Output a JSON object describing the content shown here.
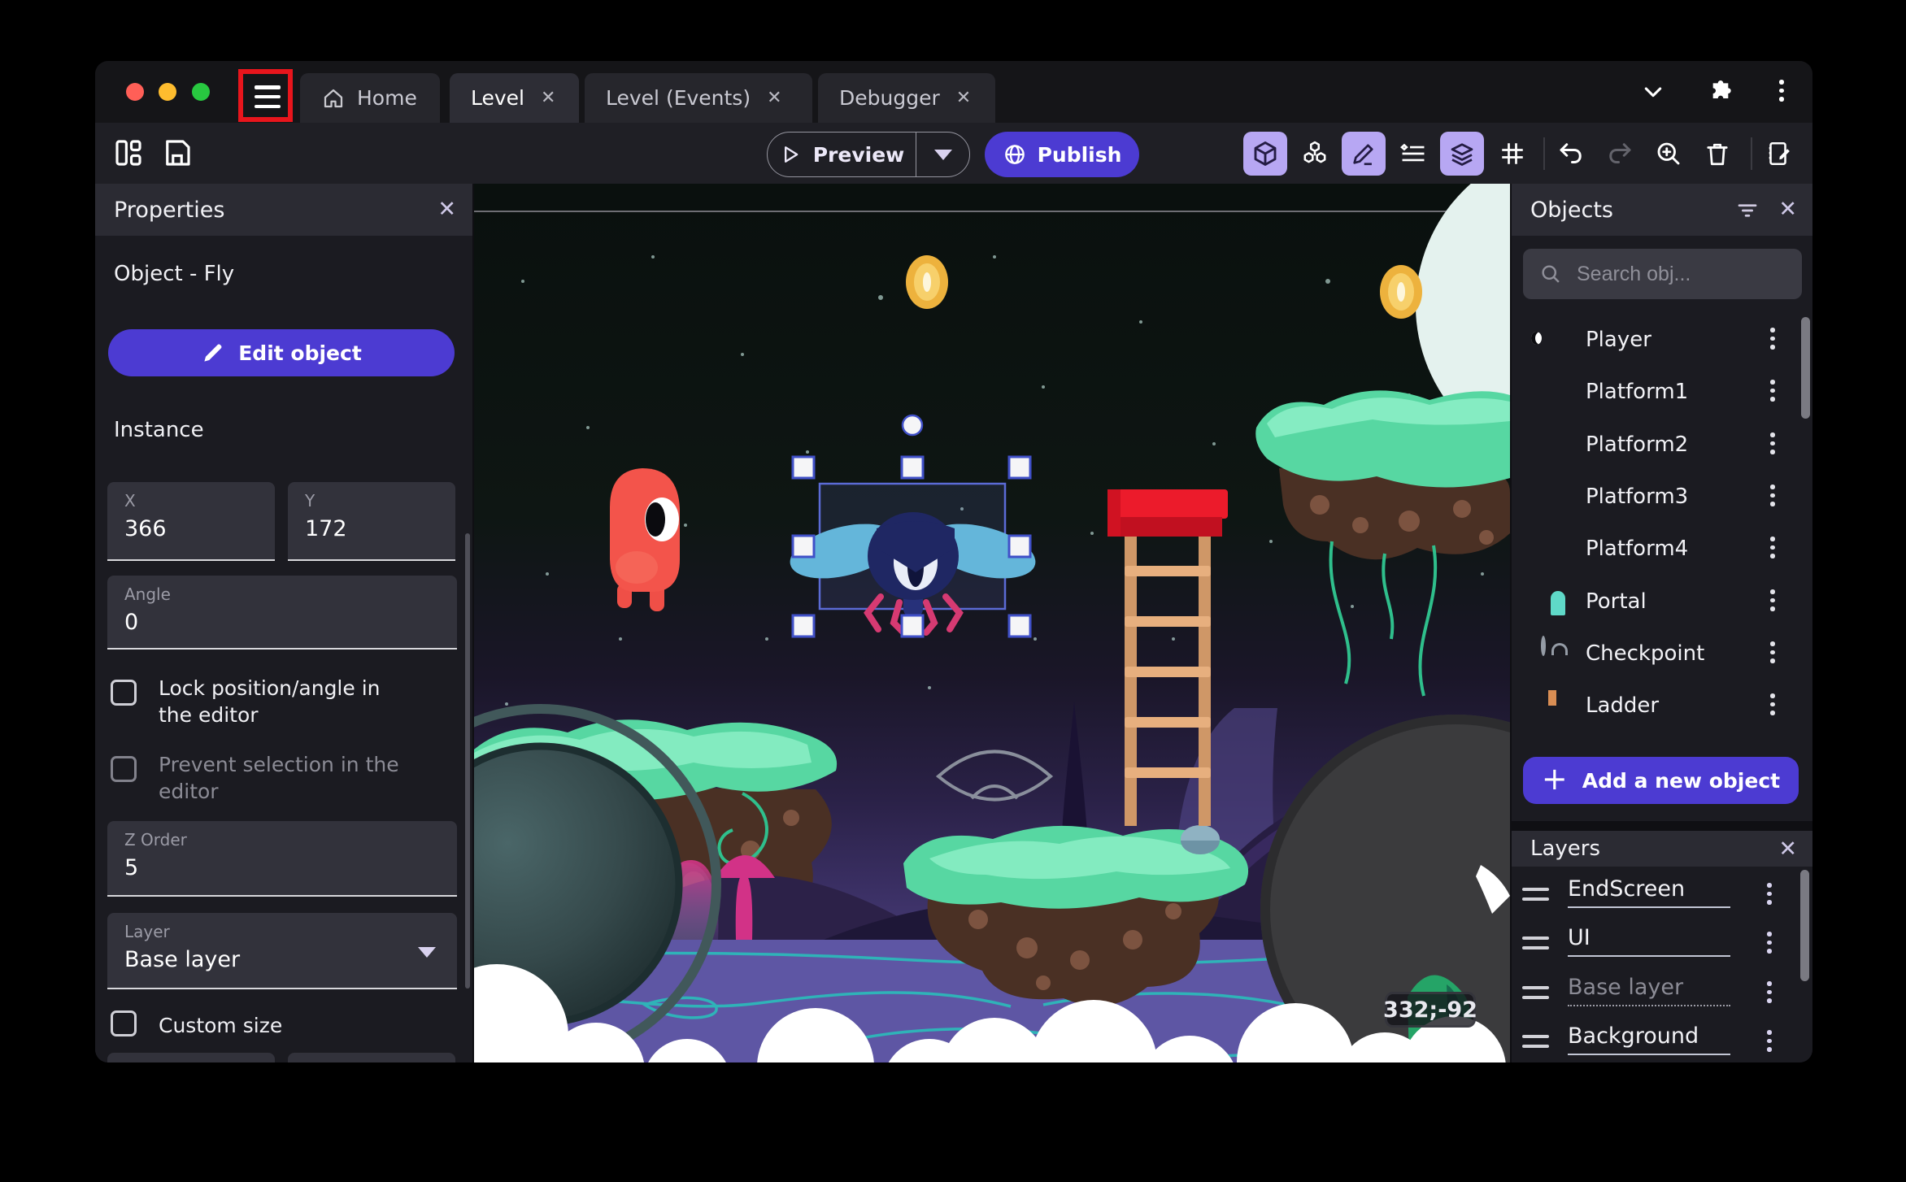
{
  "titlebar": {
    "tabs": [
      {
        "label": "Home"
      },
      {
        "label": "Level"
      },
      {
        "label": "Level (Events)"
      },
      {
        "label": "Debugger"
      }
    ],
    "close_glyph": "✕"
  },
  "toolbar": {
    "preview_label": "Preview",
    "publish_label": "Publish"
  },
  "properties_panel": {
    "title": "Properties",
    "object_heading": "Object  - Fly",
    "edit_button_label": "Edit object",
    "section_instance": "Instance",
    "x": {
      "label": "X",
      "value": "366"
    },
    "y": {
      "label": "Y",
      "value": "172"
    },
    "angle": {
      "label": "Angle",
      "value": "0"
    },
    "lock_label": "Lock position/angle in the editor",
    "prevent_label": "Prevent selection in the editor",
    "z_order": {
      "label": "Z Order",
      "value": "5"
    },
    "layer": {
      "label": "Layer",
      "value": "Base layer"
    },
    "custom_size_label": "Custom size"
  },
  "objects_panel": {
    "title": "Objects",
    "search_placeholder": "Search obj...",
    "items": [
      {
        "label": "Player"
      },
      {
        "label": "Platform1"
      },
      {
        "label": "Platform2"
      },
      {
        "label": "Platform3"
      },
      {
        "label": "Platform4"
      },
      {
        "label": "Portal"
      },
      {
        "label": "Checkpoint"
      },
      {
        "label": "Ladder"
      }
    ],
    "add_button_label": "Add a new object"
  },
  "layers_panel": {
    "title": "Layers",
    "items": [
      {
        "name": "EndScreen"
      },
      {
        "name": "UI"
      },
      {
        "name": "Base layer"
      },
      {
        "name": "Background"
      }
    ]
  },
  "canvas": {
    "coordinate_badge": "332;-92"
  },
  "colors": {
    "accent": "#4c3bd2",
    "accent_light": "#b7a7f3",
    "selection": "#5b6bd5"
  }
}
